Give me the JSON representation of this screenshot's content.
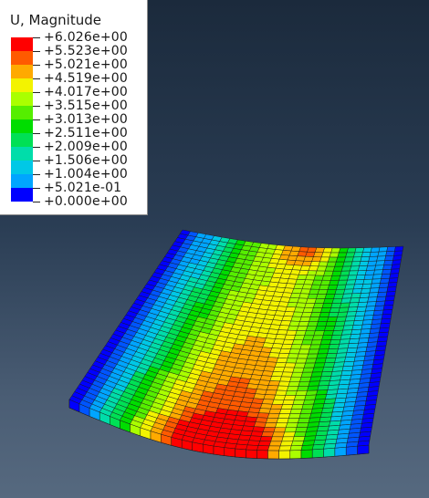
{
  "legend": {
    "title": "U, Magnitude",
    "levels": [
      {
        "label": "+6.026e+00",
        "color": "#ff0000"
      },
      {
        "label": "+5.523e+00",
        "color": "#ff5a00"
      },
      {
        "label": "+5.021e+00",
        "color": "#ffaa00"
      },
      {
        "label": "+4.519e+00",
        "color": "#f3f300"
      },
      {
        "label": "+4.017e+00",
        "color": "#aaff00"
      },
      {
        "label": "+3.515e+00",
        "color": "#55ee00"
      },
      {
        "label": "+3.013e+00",
        "color": "#00dd00"
      },
      {
        "label": "+2.511e+00",
        "color": "#00e055"
      },
      {
        "label": "+2.009e+00",
        "color": "#00ddaa"
      },
      {
        "label": "+1.506e+00",
        "color": "#00c8e6"
      },
      {
        "label": "+1.004e+00",
        "color": "#00a5ff"
      },
      {
        "label": "+5.021e-01",
        "color": "#0055ff"
      },
      {
        "label": "+0.000e+00",
        "color": "#0000ff"
      }
    ]
  },
  "contour_colors": [
    "#0000ff",
    "#0055ff",
    "#00a5ff",
    "#00c8e6",
    "#00ddaa",
    "#00e055",
    "#00dd00",
    "#55ee00",
    "#aaff00",
    "#f3f300",
    "#ffaa00",
    "#ff5a00",
    "#ff0000"
  ],
  "colors": {
    "mesh_edge": "#1a1a1a",
    "background_top": "#1b2a3c",
    "background_bottom": "#56697f"
  }
}
